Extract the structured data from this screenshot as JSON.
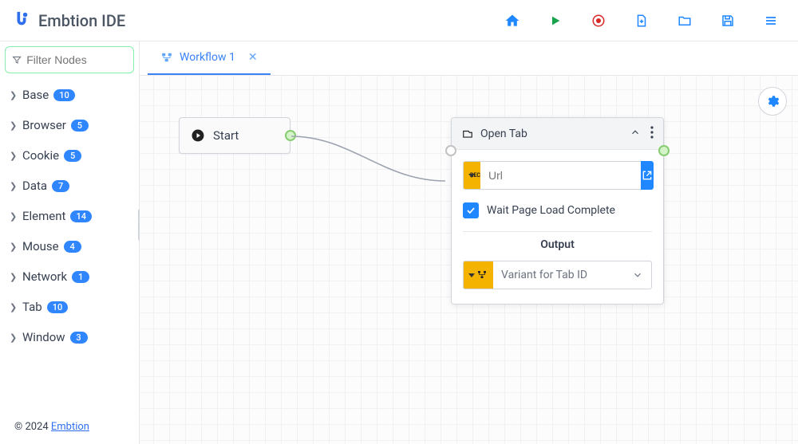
{
  "app": {
    "title": "Embtion IDE"
  },
  "sidebar": {
    "filter_placeholder": "Filter Nodes",
    "categories": [
      {
        "label": "Base",
        "count": "10"
      },
      {
        "label": "Browser",
        "count": "5"
      },
      {
        "label": "Cookie",
        "count": "5"
      },
      {
        "label": "Data",
        "count": "7"
      },
      {
        "label": "Element",
        "count": "14"
      },
      {
        "label": "Mouse",
        "count": "4"
      },
      {
        "label": "Network",
        "count": "1"
      },
      {
        "label": "Tab",
        "count": "10"
      },
      {
        "label": "Window",
        "count": "3"
      }
    ],
    "footer_prefix": "© 2024 ",
    "footer_link": "Embtion"
  },
  "tabs": [
    {
      "label": "Workflow 1"
    }
  ],
  "nodes": {
    "start": {
      "label": "Start"
    },
    "open_tab": {
      "title": "Open Tab",
      "url_placeholder": "Url",
      "wait_label": "Wait Page Load Complete",
      "wait_checked": true,
      "output_heading": "Output",
      "variant_placeholder": "Variant for Tab ID"
    }
  }
}
